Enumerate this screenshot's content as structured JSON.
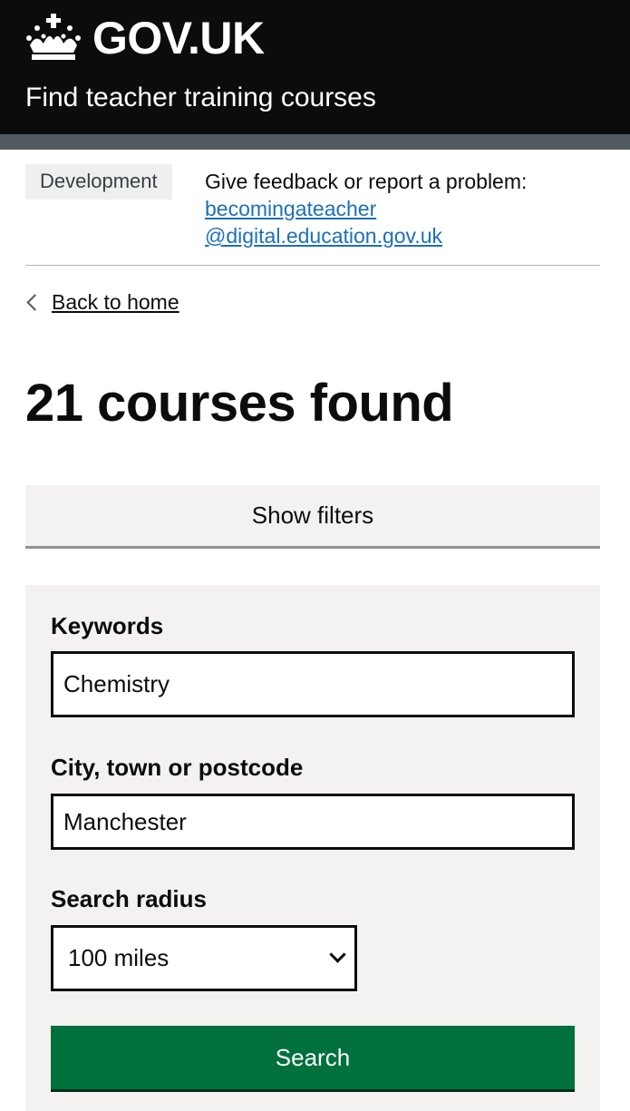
{
  "header": {
    "logo_text": "GOV.UK",
    "service_name": "Find teacher training courses"
  },
  "phase_banner": {
    "tag": "Development",
    "text": "Give feedback or report a problem:",
    "email_line_1": "becomingateacher",
    "email_line_2": "@digital.education.gov.uk"
  },
  "back_link": "Back to home",
  "page_title": "21 courses found",
  "show_filters_label": "Show filters",
  "filters": {
    "keywords_label": "Keywords",
    "keywords_value": "Chemistry",
    "location_label": "City, town or postcode",
    "location_value": "Manchester",
    "radius_label": "Search radius",
    "radius_value": "100 miles",
    "search_label": "Search"
  },
  "colors": {
    "header_bg": "#0b0c0c",
    "link": "#1d70b8",
    "button_green": "#00703c",
    "panel_bg": "#f3f2f1"
  },
  "icons": {
    "logo": "crown-icon",
    "back": "chevron-left-icon",
    "select": "chevron-down-icon"
  }
}
